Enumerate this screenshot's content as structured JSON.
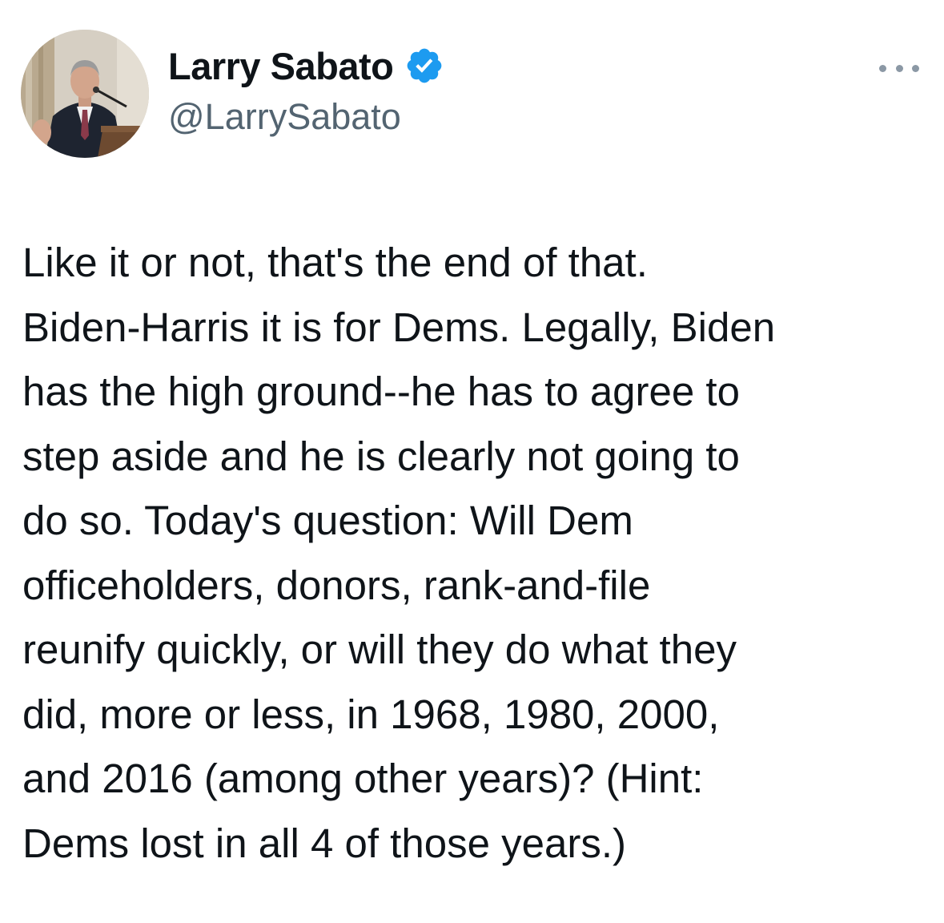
{
  "author": {
    "display_name": "Larry Sabato",
    "handle": "@LarrySabato",
    "verified": true,
    "verified_icon": "verified-badge-icon",
    "avatar_icon": "profile-photo"
  },
  "menu": {
    "icon": "more-options-icon"
  },
  "tweet": {
    "lines": [
      "Like it or not, that's the end of that.",
      "Biden-Harris it is for Dems. Legally, Biden",
      "has the high ground--he has to agree to",
      "step aside and he is clearly not going to",
      "do so. Today's question: Will Dem",
      "officeholders, donors, rank-and-file",
      "reunify quickly, or will they do what they",
      "did, more or less, in 1968, 1980, 2000,",
      "and 2016 (among other years)? (Hint:",
      "Dems lost in all 4 of those years.)"
    ]
  },
  "colors": {
    "text_primary": "#0f1419",
    "text_secondary": "#536471",
    "verified_blue": "#1d9bf0",
    "background": "#ffffff"
  }
}
